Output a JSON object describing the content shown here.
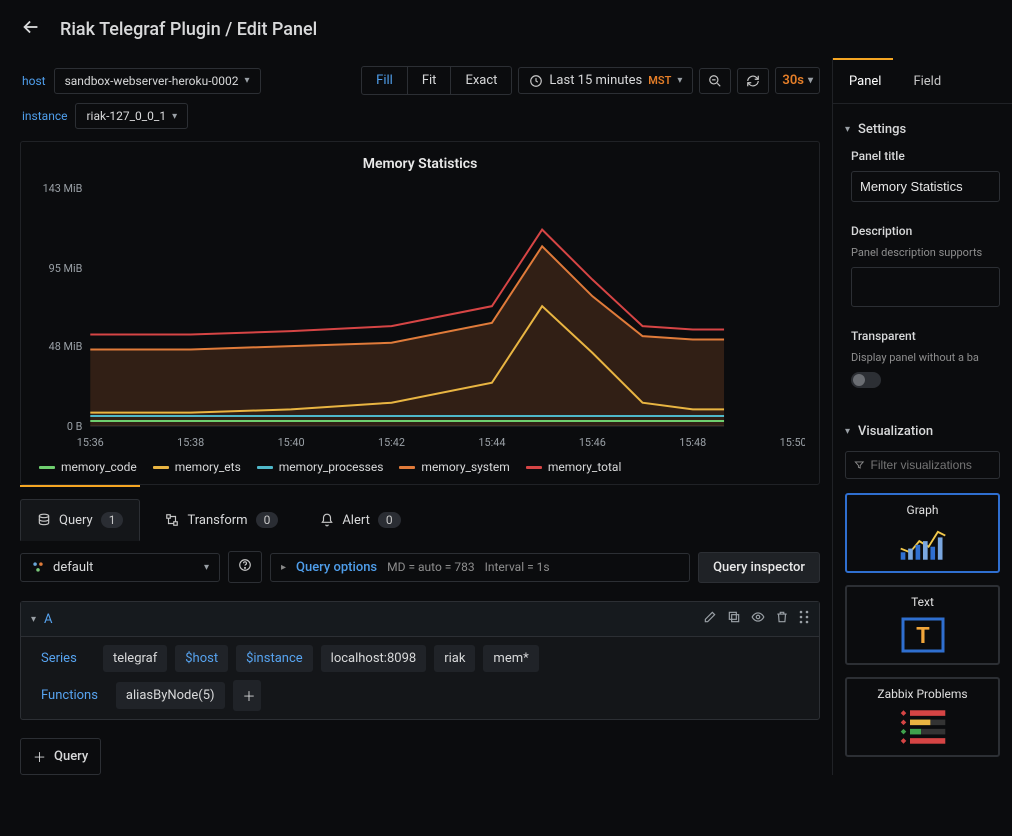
{
  "topbar": {
    "title": "Riak Telegraf Plugin / Edit Panel"
  },
  "vars": {
    "host_label": "host",
    "host_value": "sandbox-webserver-heroku-0002",
    "instance_label": "instance",
    "instance_value": "riak-127_0_0_1"
  },
  "toolbar": {
    "fill": "Fill",
    "fit": "Fit",
    "exact": "Exact",
    "time_label": "Last 15 minutes",
    "tz": "MST",
    "refresh_rate": "30s"
  },
  "panel": {
    "title": "Memory Statistics"
  },
  "legend": [
    {
      "name": "memory_code",
      "color": "#6fcf6f"
    },
    {
      "name": "memory_ets",
      "color": "#e9b542"
    },
    {
      "name": "memory_processes",
      "color": "#4fb8c9"
    },
    {
      "name": "memory_system",
      "color": "#e07b3a"
    },
    {
      "name": "memory_total",
      "color": "#d64545"
    }
  ],
  "chart_data": {
    "type": "line",
    "title": "Memory Statistics",
    "xlabel": "",
    "ylabel": "",
    "x_ticks": [
      "15:36",
      "15:38",
      "15:40",
      "15:42",
      "15:44",
      "15:46",
      "15:48",
      "15:50"
    ],
    "y_ticks": [
      "0 B",
      "48 MiB",
      "95 MiB",
      "143 MiB"
    ],
    "ylim": [
      0,
      143
    ],
    "x": [
      0,
      1,
      2,
      3,
      4,
      4.5,
      5,
      5.5,
      6,
      7
    ],
    "series": [
      {
        "name": "memory_code",
        "color": "#6fcf6f",
        "values": [
          3,
          3,
          3,
          3,
          3,
          3,
          3,
          3,
          3,
          3
        ]
      },
      {
        "name": "memory_ets",
        "color": "#e9b542",
        "values": [
          8,
          8,
          10,
          14,
          26,
          72,
          44,
          14,
          10,
          10
        ]
      },
      {
        "name": "memory_processes",
        "color": "#4fb8c9",
        "values": [
          6,
          6,
          6,
          6,
          6,
          6,
          6,
          6,
          6,
          6
        ]
      },
      {
        "name": "memory_system",
        "color": "#e07b3a",
        "values": [
          46,
          46,
          48,
          50,
          62,
          108,
          78,
          54,
          52,
          52
        ]
      },
      {
        "name": "memory_total",
        "color": "#d64545",
        "values": [
          55,
          55,
          57,
          60,
          72,
          118,
          88,
          60,
          58,
          58
        ]
      }
    ]
  },
  "editor_tabs": {
    "query": "Query",
    "query_count": "1",
    "transform": "Transform",
    "transform_count": "0",
    "alert": "Alert",
    "alert_count": "0"
  },
  "datasource": {
    "name": "default"
  },
  "qopts": {
    "label": "Query options",
    "md": "MD = auto = 783",
    "interval": "Interval = 1s"
  },
  "qinspector": "Query inspector",
  "query": {
    "ref_id": "A",
    "series_label": "Series",
    "segments": [
      "telegraf",
      "$host",
      "$instance",
      "localhost:8098",
      "riak",
      "mem*"
    ],
    "functions_label": "Functions",
    "fn": "aliasByNode(5)"
  },
  "add_query": "Query",
  "side": {
    "tab_panel": "Panel",
    "tab_field": "Field",
    "settings": "Settings",
    "panel_title_label": "Panel title",
    "panel_title_value": "Memory Statistics",
    "description_label": "Description",
    "description_hint": "Panel description supports",
    "transparent_label": "Transparent",
    "transparent_hint": "Display panel without a ba",
    "visualization": "Visualization",
    "filter_placeholder": "Filter visualizations",
    "viz_graph": "Graph",
    "viz_text": "Text",
    "viz_zabbix": "Zabbix Problems"
  }
}
